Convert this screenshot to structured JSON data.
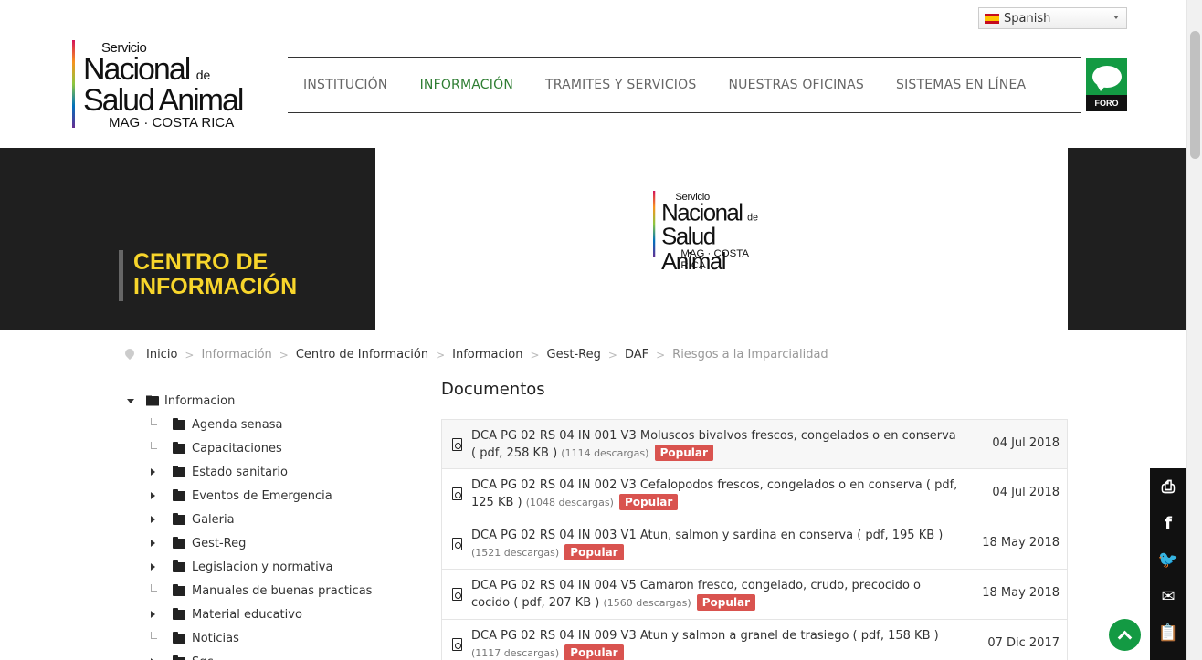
{
  "language": {
    "selected": "Spanish"
  },
  "logo": {
    "line1": "Servicio",
    "line2": "Nacional",
    "line2_small": "de",
    "line3": "Salud Animal",
    "line4": "MAG · COSTA RICA"
  },
  "nav": [
    {
      "label": "INSTITUCIÓN",
      "active": false
    },
    {
      "label": "INFORMACIÓN",
      "active": true
    },
    {
      "label": "TRAMITES Y SERVICIOS",
      "active": false
    },
    {
      "label": "NUESTRAS OFICINAS",
      "active": false
    },
    {
      "label": "SISTEMAS EN LÍNEA",
      "active": false
    }
  ],
  "foro": {
    "label": "FORO"
  },
  "hero": {
    "title_line1": "CENTRO DE",
    "title_line2": "INFORMACIÓN"
  },
  "breadcrumb": [
    {
      "label": "Inicio",
      "muted": false
    },
    {
      "label": "Información",
      "muted": true
    },
    {
      "label": "Centro de Información",
      "muted": false
    },
    {
      "label": "Informacion",
      "muted": false
    },
    {
      "label": "Gest-Reg",
      "muted": false
    },
    {
      "label": "DAF",
      "muted": false
    },
    {
      "label": "Riesgos a la Imparcialidad",
      "muted": true
    }
  ],
  "tree": {
    "root": "Informacion",
    "children": [
      {
        "label": "Agenda senasa",
        "expandable": false
      },
      {
        "label": "Capacitaciones",
        "expandable": false
      },
      {
        "label": "Estado sanitario",
        "expandable": true
      },
      {
        "label": "Eventos de Emergencia",
        "expandable": true
      },
      {
        "label": "Galeria",
        "expandable": true
      },
      {
        "label": "Gest-Reg",
        "expandable": true
      },
      {
        "label": "Legislacion y normativa",
        "expandable": true
      },
      {
        "label": "Manuales de buenas practicas",
        "expandable": false
      },
      {
        "label": "Material educativo",
        "expandable": true
      },
      {
        "label": "Noticias",
        "expandable": false
      },
      {
        "label": "Sgc",
        "expandable": true
      }
    ]
  },
  "documents": {
    "title": "Documentos",
    "badge": "Popular",
    "items": [
      {
        "name": "DCA PG 02 RS 04 IN 001 V3 Moluscos bivalvos frescos, congelados o en conserva ( pdf, 258 KB )",
        "downloads": "(1114 descargas)",
        "date": "04 Jul 2018"
      },
      {
        "name": "DCA PG 02 RS 04 IN 002 V3 Cefalopodos frescos, congelados o en conserva ( pdf, 125 KB )",
        "downloads": "(1048 descargas)",
        "date": "04 Jul 2018"
      },
      {
        "name": "DCA PG 02 RS 04 IN 003 V1 Atun, salmon y sardina en conserva ( pdf, 195 KB )",
        "downloads": "(1521 descargas)",
        "date": "18 May 2018"
      },
      {
        "name": "DCA PG 02 RS 04 IN 004 V5 Camaron fresco, congelado, crudo, precocido o cocido ( pdf, 207 KB )",
        "downloads": "(1560 descargas)",
        "date": "18 May 2018"
      },
      {
        "name": "DCA PG 02 RS 04 IN 009 V3 Atun y salmon a granel de trasiego ( pdf, 158 KB )",
        "downloads": "(1117 descargas)",
        "date": "07 Dic 2017"
      }
    ]
  },
  "social": [
    {
      "icon": "print-icon",
      "glyph": "⎙"
    },
    {
      "icon": "facebook-icon",
      "glyph": "f"
    },
    {
      "icon": "twitter-icon",
      "glyph": "🐦"
    },
    {
      "icon": "email-icon",
      "glyph": "✉"
    },
    {
      "icon": "clipboard-icon",
      "glyph": "📋"
    }
  ]
}
